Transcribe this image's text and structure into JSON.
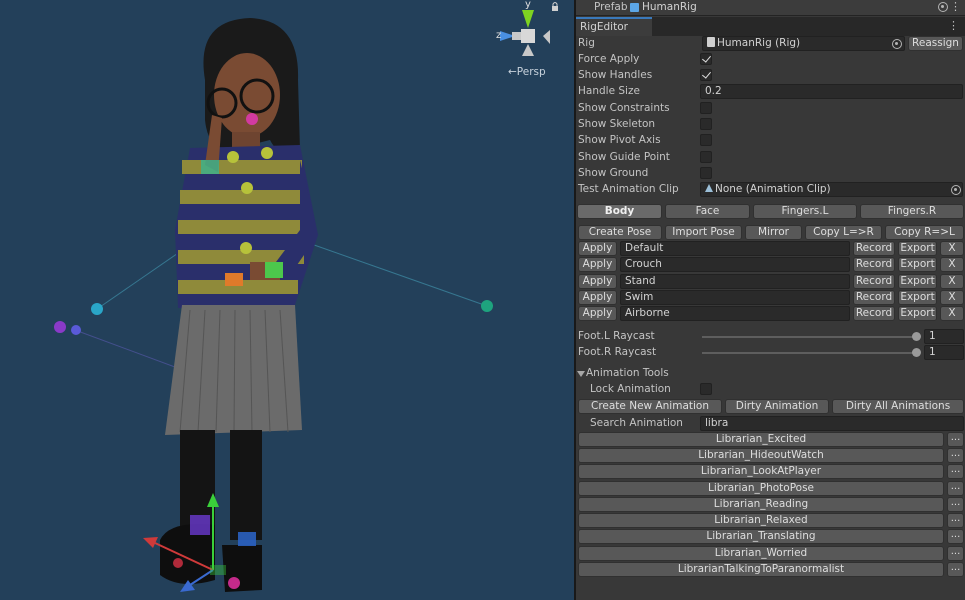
{
  "scene": {
    "persp_label": "←Persp",
    "gizmo_axes": {
      "y": "y",
      "z": "z"
    }
  },
  "inspector": {
    "prefab": {
      "label": "Prefab",
      "value": "HumanRig"
    },
    "tab": {
      "label": "RigEditor"
    },
    "rig": {
      "label": "Rig",
      "value": "HumanRig (Rig)",
      "reassign": "Reassign"
    },
    "toggles": [
      {
        "label": "Force Apply",
        "checked": true
      },
      {
        "label": "Show Handles",
        "checked": true
      }
    ],
    "handle_size": {
      "label": "Handle Size",
      "value": "0.2"
    },
    "toggles2": [
      {
        "label": "Show Constraints",
        "checked": false
      },
      {
        "label": "Show Skeleton",
        "checked": false
      },
      {
        "label": "Show Pivot Axis",
        "checked": false
      },
      {
        "label": "Show Guide Point",
        "checked": false
      },
      {
        "label": "Show Ground",
        "checked": false
      }
    ],
    "test_clip": {
      "label": "Test Animation Clip",
      "value": "None (Animation Clip)"
    },
    "section_tabs": [
      "Body",
      "Face",
      "Fingers.L",
      "Fingers.R"
    ],
    "active_section": "Body",
    "pose_buttons": [
      "Create Pose",
      "Import Pose",
      "Mirror",
      "Copy L=>R",
      "Copy R=>L"
    ],
    "pose_rows": [
      {
        "apply": "Apply",
        "name": "Default",
        "record": "Record",
        "export": "Export",
        "remove": "X"
      },
      {
        "apply": "Apply",
        "name": "Crouch",
        "record": "Record",
        "export": "Export",
        "remove": "X"
      },
      {
        "apply": "Apply",
        "name": "Stand",
        "record": "Record",
        "export": "Export",
        "remove": "X"
      },
      {
        "apply": "Apply",
        "name": "Swim",
        "record": "Record",
        "export": "Export",
        "remove": "X"
      },
      {
        "apply": "Apply",
        "name": "Airborne",
        "record": "Record",
        "export": "Export",
        "remove": "X"
      }
    ],
    "raycasts": [
      {
        "label": "Foot.L Raycast",
        "value": "1",
        "fraction": 1.0
      },
      {
        "label": "Foot.R Raycast",
        "value": "1",
        "fraction": 1.0
      }
    ],
    "animation_tools": {
      "title": "Animation Tools",
      "lock_label": "Lock Animation",
      "lock_checked": false,
      "buttons": [
        "Create New Animation",
        "Dirty Animation",
        "Dirty All Animations"
      ],
      "search_label": "Search Animation",
      "search_value": "libra",
      "results": [
        "Librarian_Excited",
        "Librarian_HideoutWatch",
        "Librarian_LookAtPlayer",
        "Librarian_PhotoPose",
        "Librarian_Reading",
        "Librarian_Relaxed",
        "Librarian_Translating",
        "Librarian_Worried",
        "LibrarianTalkingToParanormalist"
      ],
      "more_label": "..."
    }
  },
  "colors": {
    "scene_bg": "#23405a",
    "panel_bg": "#383838",
    "field_bg": "#2a2a2a",
    "button_bg": "#585858",
    "accent": "#3a79bb"
  }
}
